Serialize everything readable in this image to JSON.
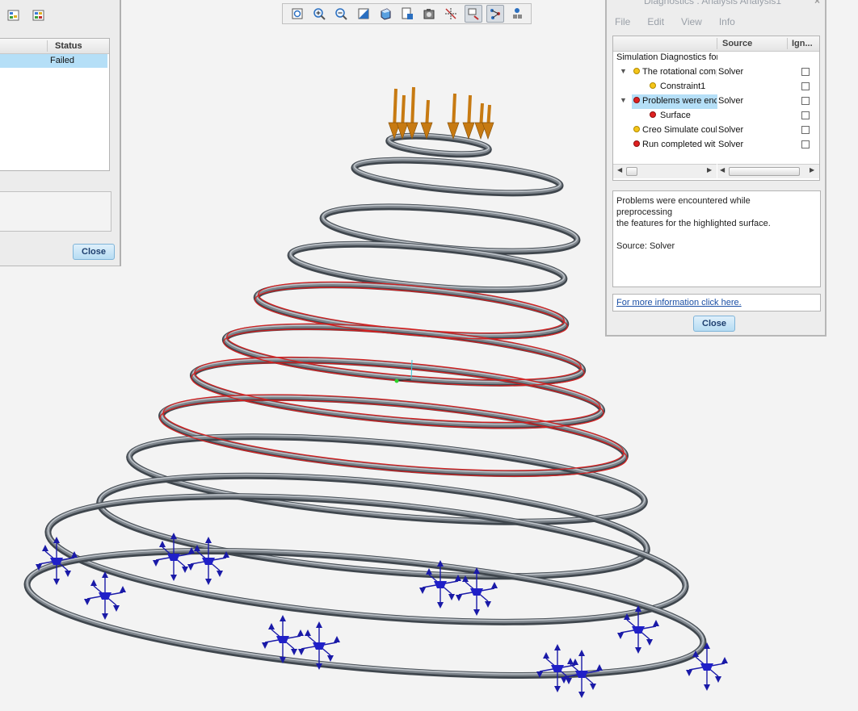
{
  "left_panel": {
    "table_header_status": "Status",
    "row_status": "Failed",
    "close_label": "Close"
  },
  "view_toolbar": {
    "icons": [
      "refit-icon",
      "zoom-in-icon",
      "zoom-out-icon",
      "repaint-icon",
      "display-style-icon",
      "saved-orientations-icon",
      "view-manager-icon",
      "datum-display-icon",
      "spin-center-icon",
      "annotation-display-icon",
      "model-tree-icon"
    ]
  },
  "diagnostics": {
    "title": "Diagnostics : Analysis Analysis1",
    "close_x": "×",
    "menu": [
      "File",
      "Edit",
      "View",
      "Info"
    ],
    "columns": {
      "source": "Source",
      "ignore": "Ign..."
    },
    "root_label": "Simulation Diagnostics for",
    "rows": [
      {
        "name": "The rotational comp",
        "source": "Solver",
        "level": 1,
        "dot": "yellow",
        "expanded": true
      },
      {
        "name": "Constraint1",
        "source": "",
        "level": 2,
        "dot": "yellow"
      },
      {
        "name": "Problems were enc",
        "source": "Solver",
        "level": 1,
        "dot": "red",
        "expanded": true,
        "selected": true
      },
      {
        "name": "Surface",
        "source": "",
        "level": 2,
        "dot": "red"
      },
      {
        "name": "Creo Simulate coul",
        "source": "Solver",
        "level": 1,
        "dot": "yellow"
      },
      {
        "name": "Run completed wit",
        "source": "Solver",
        "level": 1,
        "dot": "red"
      }
    ],
    "message_lines": [
      "Problems were encountered while",
      "preprocessing",
      "the features for the highlighted surface.",
      "",
      "Source: Solver"
    ],
    "link": "For more information click here.",
    "close_label": "Close"
  },
  "colors": {
    "coil": "#7d848b",
    "highlight": "#d42020",
    "load_arrow": "#c77a12",
    "constraint": "#1a1aa8",
    "selection": "#b5dff7"
  }
}
